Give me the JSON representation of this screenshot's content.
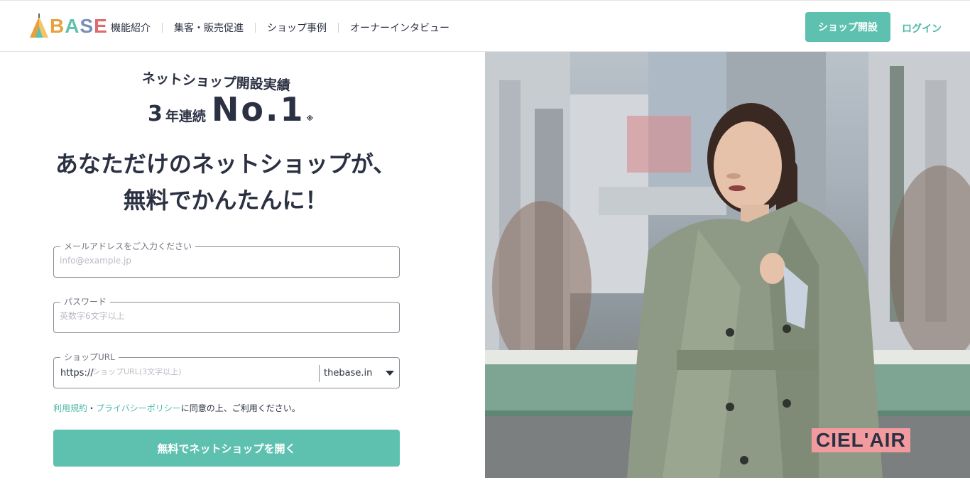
{
  "header": {
    "logo_text": "BASE",
    "nav": [
      "機能紹介",
      "集客・販売促進",
      "ショップ事例",
      "オーナーインタビュー"
    ],
    "open_shop_label": "ショップ開設",
    "login_label": "ログイン"
  },
  "hero_copy": {
    "badge_top": "ネットショップ開設実績",
    "rank_years": "3",
    "rank_years_suffix": "年連続",
    "rank_label": "No.1",
    "rank_note": "※",
    "headline_line1": "あなただけのネットショップが、",
    "headline_line2": "無料でかんたんに！"
  },
  "form": {
    "email": {
      "label": "メールアドレスをご入力ください",
      "placeholder": "info@example.jp",
      "value": ""
    },
    "password": {
      "label": "パスワード",
      "placeholder": "英数字6文字以上",
      "value": ""
    },
    "shop_url": {
      "label": "ショップURL",
      "prefix": "https://",
      "placeholder": "ショップURL(3文字以上)",
      "domain": "thebase.in"
    },
    "terms_link": "利用規約",
    "terms_sep": "・",
    "privacy_link": "プライバシーポリシー",
    "terms_suffix": "に同意の上、ご利用ください。",
    "submit_label": "無料でネットショップを開く"
  },
  "image": {
    "brand_tag": "CIEL'AIR"
  },
  "colors": {
    "accent": "#5ec1b0",
    "link": "#4db8a6",
    "text": "#2b3142",
    "brand_tag_bg": "#f29b9f"
  }
}
